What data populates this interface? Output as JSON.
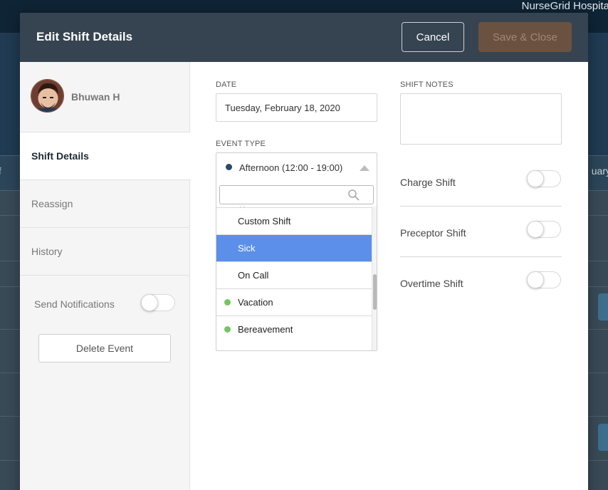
{
  "background": {
    "app_name": "NurseGrid Hospita",
    "left_fragment": "f",
    "right_fragment": "uary"
  },
  "modal": {
    "title": "Edit Shift Details",
    "cancel_label": "Cancel",
    "save_label": "Save & Close"
  },
  "profile": {
    "name": "Bhuwan H"
  },
  "sidebar": {
    "items": [
      {
        "label": "Shift Details",
        "active": true
      },
      {
        "label": "Reassign",
        "active": false
      },
      {
        "label": "History",
        "active": false
      }
    ],
    "notifications_label": "Send Notifications",
    "notifications_on": false,
    "delete_label": "Delete Event"
  },
  "form": {
    "date_label": "DATE",
    "date_value": "Tuesday, February 18, 2020",
    "event_type_label": "EVENT TYPE",
    "event_type_value": "Afternoon (12:00 - 19:00)",
    "event_type_dot_color": "#2a4a66",
    "search_value": "",
    "clipped_option": "(               )",
    "options": [
      {
        "label": "Custom Shift",
        "dot": false,
        "selected": false
      },
      {
        "label": "Sick",
        "dot": false,
        "selected": true
      },
      {
        "label": "On Call",
        "dot": false,
        "selected": false
      },
      {
        "label": "Vacation",
        "dot": true,
        "selected": false
      },
      {
        "label": "Bereavement",
        "dot": true,
        "selected": false
      }
    ],
    "option_dot_color": "#76c463",
    "highlight_color": "#5b8fe9",
    "notes_label": "SHIFT NOTES",
    "notes_value": "",
    "switches": [
      {
        "label": "Charge Shift",
        "on": false
      },
      {
        "label": "Preceptor Shift",
        "on": false
      },
      {
        "label": "Overtime Shift",
        "on": false
      }
    ]
  }
}
